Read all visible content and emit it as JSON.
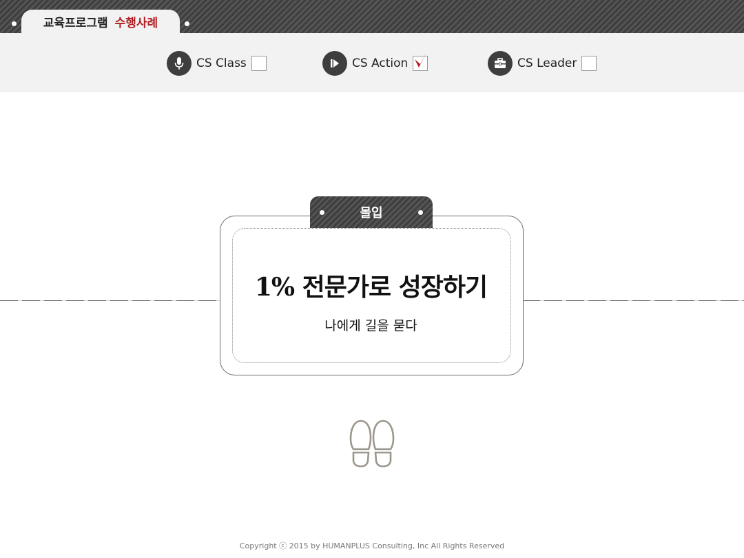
{
  "header": {
    "tab_title_dark": "교육프로그램",
    "tab_title_red": "수행사례",
    "accent_color": "#b01e23"
  },
  "nav": {
    "items": [
      {
        "label": "CS Class",
        "icon": "microphone-icon",
        "checked": false
      },
      {
        "label": "CS Action",
        "icon": "play-icon",
        "checked": true
      },
      {
        "label": "CS Leader",
        "icon": "briefcase-icon",
        "checked": false
      }
    ]
  },
  "card": {
    "tab_label": "몰입",
    "headline": "1% 전문가로 성장하기",
    "subtitle": "나에게 길을 묻다"
  },
  "decoration": {
    "footprints_icon": "footprints-icon"
  },
  "footer": {
    "copyright": "Copyright ⓒ 2015 by HUMANPLUS Consulting, Inc All Rights Reserved"
  }
}
